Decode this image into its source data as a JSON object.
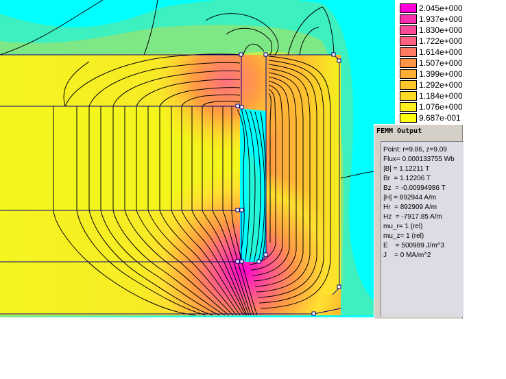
{
  "legend": {
    "entries": [
      {
        "label": "2.045e+000",
        "color": "#ff00d8"
      },
      {
        "label": "1.937e+000",
        "color": "#ff30b0"
      },
      {
        "label": "1.830e+000",
        "color": "#ff4a98"
      },
      {
        "label": "1.722e+000",
        "color": "#ff6180"
      },
      {
        "label": "1.614e+000",
        "color": "#ff7a60"
      },
      {
        "label": "1.507e+000",
        "color": "#ff9545"
      },
      {
        "label": "1.399e+000",
        "color": "#ffae35"
      },
      {
        "label": "1.292e+000",
        "color": "#ffc52a"
      },
      {
        "label": "1.184e+000",
        "color": "#ffdb25"
      },
      {
        "label": "1.076e+000",
        "color": "#ffee20"
      },
      {
        "label": "9.687e-001",
        "color": "#ffff10"
      }
    ]
  },
  "output_window": {
    "title": "FEMM Output",
    "lines": [
      "Point: r=9.86, z=9.09",
      "Flux= 0.000133755 Wb",
      "|B| = 1.12211 T",
      "Br  = 1.12206 T",
      "Bz  = -0.00994986 T",
      "|H| = 892944 A/m",
      "Hr  = 892909 A/m",
      "Hz  = -7917.85 A/m",
      "mu_r= 1 (rel)",
      "mu_z= 1 (rel)",
      "E    = 500989 J/m^3",
      "J    = 0 MA/m^2"
    ]
  },
  "colors": {
    "cyan_background": "#00ffff",
    "field_low": "#33f5c4",
    "field_mid": "#9cf070",
    "field_core": "#f3f51e",
    "field_high": "#ff8a40",
    "field_peak": "#ff30c8",
    "contour_line": "#000000",
    "geometry_line": "#000080"
  }
}
